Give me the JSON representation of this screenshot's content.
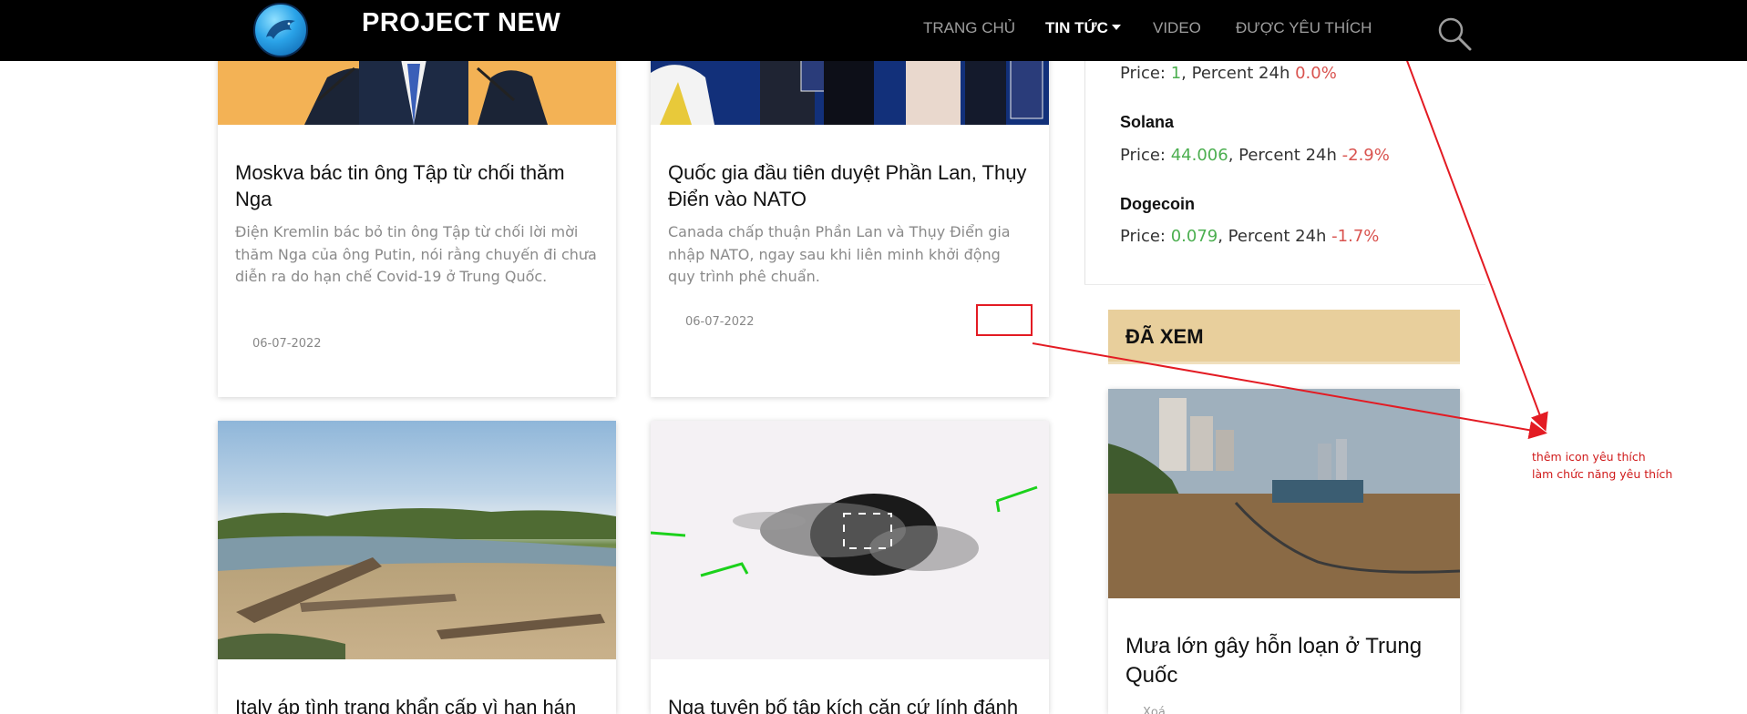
{
  "navbar": {
    "brand": "PROJECT NEW",
    "links": [
      {
        "label": "TRANG CHỦ"
      },
      {
        "label": "TIN TỨC"
      },
      {
        "label": "VIDEO"
      },
      {
        "label": "ĐƯỢC YÊU THÍCH"
      }
    ]
  },
  "cards": [
    {
      "title": "Moskva bác tin ông Tập từ chối thăm Nga",
      "description": "Điện Kremlin bác bỏ tin ông Tập từ chối lời mời thăm Nga của ông Putin, nói rằng chuyến đi chưa diễn ra do hạn chế Covid-19 ở Trung Quốc.",
      "date": "06-07-2022"
    },
    {
      "title": "Quốc gia đầu tiên duyệt Phần Lan, Thụy Điển vào NATO",
      "description": "Canada chấp thuận Phần Lan và Thụy Điển gia nhập NATO, ngay sau khi liên minh khởi động quy trình phê chuẩn.",
      "date": "06-07-2022"
    },
    {
      "title": "Italy áp tình trạng khẩn cấp vì hạn hán"
    },
    {
      "title": "Nga tuyên bố tập kích căn cứ lính đánh"
    }
  ],
  "crypto": {
    "first_line": {
      "price_label": "Price: ",
      "price": "1",
      "pct_label": ", Percent 24h ",
      "pct": "0.0%"
    },
    "coins": [
      {
        "name": "Solana",
        "price_label": "Price: ",
        "price": "44.006",
        "pct_label": ", Percent 24h ",
        "pct": "-2.9%"
      },
      {
        "name": "Dogecoin",
        "price_label": "Price: ",
        "price": "0.079",
        "pct_label": ", Percent 24h ",
        "pct": "-1.7%"
      }
    ]
  },
  "seen": {
    "heading": "ĐÃ XEM",
    "item": {
      "title": "Mưa lớn gây hỗn loạn ở Trung Quốc",
      "delete_label": "Xoá"
    }
  },
  "annotation": {
    "line1": "thêm icon yêu thích",
    "line2": "làm chức năng yêu thích"
  },
  "colors": {
    "navbar": "#000000",
    "positive": "#4caf50",
    "negative": "#d9534f",
    "seen_box": "#e8cf9c",
    "annotation": "#e31b23"
  },
  "icons": [
    "dolphin-logo-icon",
    "search-icon",
    "caret-down-icon"
  ]
}
